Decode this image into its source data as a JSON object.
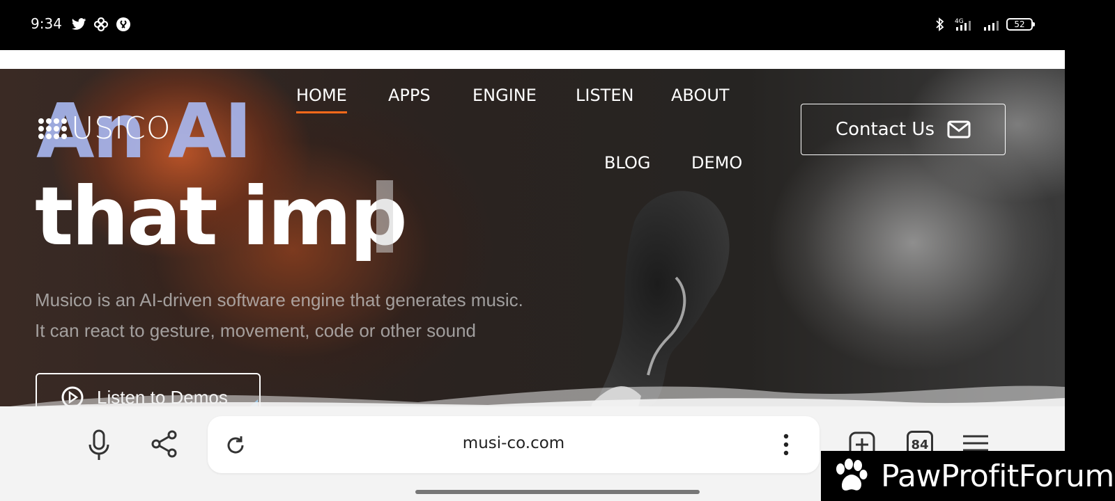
{
  "status_bar": {
    "time": "9:34",
    "left_icons": [
      "twitter-icon",
      "pinwheel-icon",
      "shazam-icon"
    ],
    "right_icons": [
      "bluetooth-icon",
      "signal-4g-icon",
      "signal-icon"
    ],
    "battery": "52"
  },
  "site": {
    "logo_text": "USICO",
    "nav": [
      {
        "label": "HOME",
        "active": true
      },
      {
        "label": "APPS"
      },
      {
        "label": "ENGINE"
      },
      {
        "label": "LISTEN"
      },
      {
        "label": "ABOUT"
      },
      {
        "label": "BLOG"
      },
      {
        "label": "DEMO"
      }
    ],
    "contact_label": "Contact Us",
    "headline_line1": "An AI",
    "headline_line2": "that imp",
    "description_line1": "Musico is an AI-driven software engine that generates music.",
    "description_line2": "It can react to gesture, movement, code or other sound",
    "demo_button_label": "Listen to Demos"
  },
  "browser": {
    "url": "musi-co.com",
    "tab_count": "84",
    "icons": [
      "microphone-icon",
      "share-icon",
      "reload-icon",
      "more-vert-icon",
      "new-tab-icon",
      "menu-icon"
    ]
  },
  "watermark": {
    "text": "PawProfitForum"
  },
  "colors": {
    "nav_active_underline": "#ff6a1a",
    "headline_accent": "#a9b9f2",
    "demo_accent": "#4aa8ea"
  }
}
